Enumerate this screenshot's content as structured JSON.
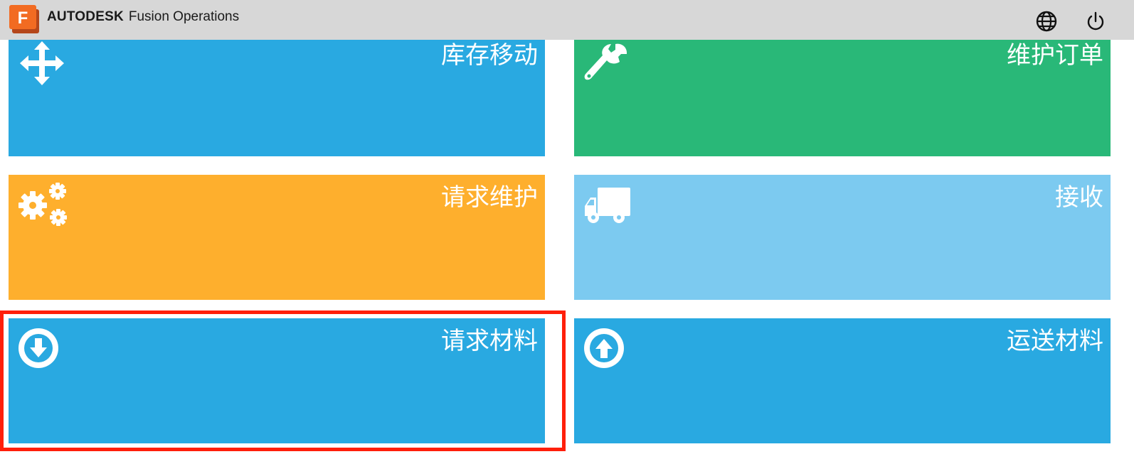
{
  "header": {
    "brand_bold": "AUTODESK",
    "brand_product": "Fusion Operations",
    "logo_letter": "F",
    "logo_icon": "fusion-logo-icon",
    "language_icon": "globe-icon",
    "logout_icon": "power-icon"
  },
  "tiles": [
    {
      "label": "库存移动",
      "icon": "move-arrows-icon",
      "color": "#29a9e1"
    },
    {
      "label": "维护订单",
      "icon": "wrench-icon",
      "color": "#29b878"
    },
    {
      "label": "请求维护",
      "icon": "gears-icon",
      "color": "#feaf2d"
    },
    {
      "label": "接收",
      "icon": "truck-icon",
      "color": "#7ccaf0"
    },
    {
      "label": "请求材料",
      "icon": "download-circle-icon",
      "color": "#29a9e1",
      "highlighted": true
    },
    {
      "label": "运送材料",
      "icon": "upload-circle-icon",
      "color": "#29a9e1"
    }
  ],
  "colors": {
    "topbar": "#d7d7d7",
    "highlight_border": "#ff1f0a",
    "logo_orange": "#f26b22"
  }
}
